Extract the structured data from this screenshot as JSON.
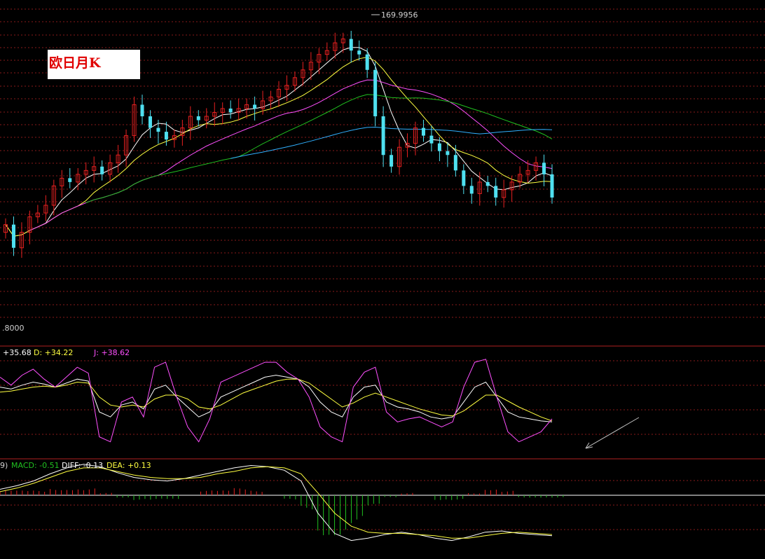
{
  "title": "欧日月K",
  "high_label": "169.9956",
  "low_axis_label": ".8000",
  "kdj": {
    "label_k": "+35.68",
    "label_d": "D: +34.22",
    "label_j": "J: +38.62"
  },
  "macd": {
    "label_prefix": "9)",
    "label_macd": "MACD: -0.51",
    "label_diff": "DIFF: -0.13",
    "label_dea": "DEA: +0.13"
  },
  "colors": {
    "background": "#000000",
    "grid": "#8a1a1a",
    "up": "#e82020",
    "down": "#4fe0f0",
    "ma5": "#ffffff",
    "ma10": "#ffff40",
    "ma20": "#ff50ff",
    "ma30": "#20c020",
    "ma60": "#30b0ff",
    "kdj_k": "#ffffff",
    "kdj_d": "#ffff40",
    "kdj_j": "#ff50ff",
    "macd_diff": "#ffffff",
    "macd_dea": "#ffff40",
    "macd_pos": "#e82020",
    "macd_neg": "#20c020"
  },
  "chart_data": [
    {
      "type": "candlestick",
      "title": "欧日月K",
      "y_labels_visible": [
        ".8000",
        "169.9956"
      ],
      "series": [
        {
          "name": "price",
          "close": [
            118,
            112,
            116,
            120,
            121,
            123,
            128,
            130,
            129,
            131,
            132,
            133,
            131,
            134,
            136,
            141,
            149,
            146,
            143,
            142,
            140,
            141,
            143,
            146,
            145,
            146,
            147,
            148,
            147,
            148,
            149,
            148,
            150,
            151,
            153,
            154,
            156,
            158,
            160,
            162,
            163,
            165,
            166,
            163,
            162,
            158,
            146,
            136,
            133,
            138,
            139,
            143,
            141,
            139,
            137,
            136,
            132,
            128,
            126,
            129,
            128,
            125,
            127,
            129,
            131,
            132,
            134,
            131,
            125
          ]
        }
      ]
    },
    {
      "type": "line",
      "title": "KDJ",
      "series": [
        {
          "name": "K",
          "values": [
            70,
            68,
            72,
            75,
            73,
            70,
            74,
            78,
            76,
            45,
            40,
            52,
            55,
            48,
            68,
            72,
            60,
            50,
            40,
            45,
            60,
            65,
            70,
            75,
            80,
            82,
            80,
            78,
            70,
            55,
            45,
            40,
            60,
            70,
            72,
            55,
            50,
            48,
            45,
            40,
            38,
            40,
            55,
            70,
            75,
            60,
            45,
            40,
            38,
            36,
            35
          ]
        },
        {
          "name": "D",
          "values": [
            65,
            66,
            68,
            70,
            71,
            70,
            72,
            75,
            74,
            60,
            52,
            50,
            52,
            50,
            58,
            62,
            62,
            58,
            50,
            48,
            52,
            58,
            64,
            68,
            72,
            76,
            78,
            78,
            74,
            66,
            58,
            50,
            54,
            60,
            64,
            60,
            56,
            52,
            48,
            45,
            42,
            41,
            46,
            54,
            62,
            62,
            56,
            50,
            45,
            40,
            36
          ]
        },
        {
          "name": "J",
          "values": [
            80,
            72,
            82,
            88,
            78,
            70,
            80,
            90,
            84,
            20,
            15,
            55,
            60,
            40,
            90,
            95,
            60,
            30,
            15,
            38,
            75,
            80,
            85,
            90,
            95,
            95,
            85,
            78,
            60,
            30,
            20,
            15,
            70,
            85,
            90,
            45,
            35,
            38,
            40,
            35,
            30,
            35,
            70,
            95,
            98,
            60,
            25,
            15,
            20,
            25,
            38
          ]
        }
      ]
    },
    {
      "type": "bar",
      "title": "MACD",
      "series": [
        {
          "name": "DIFF",
          "values": [
            0.5,
            0.8,
            1.2,
            1.8,
            2.3,
            2.6,
            2.4,
            1.9,
            1.5,
            1.3,
            1.2,
            1.4,
            1.7,
            2.0,
            2.3,
            2.5,
            2.4,
            2.1,
            1.2,
            -1.5,
            -3.2,
            -3.8,
            -3.6,
            -3.3,
            -3.1,
            -3.3,
            -3.6,
            -3.8,
            -3.5,
            -3.1,
            -3.0,
            -3.2,
            -3.3,
            -3.4
          ]
        },
        {
          "name": "DEA",
          "values": [
            0.3,
            0.6,
            1.0,
            1.5,
            2.0,
            2.3,
            2.3,
            2.0,
            1.7,
            1.5,
            1.4,
            1.4,
            1.5,
            1.8,
            2.0,
            2.3,
            2.4,
            2.3,
            1.8,
            0.2,
            -1.5,
            -2.6,
            -3.1,
            -3.2,
            -3.2,
            -3.3,
            -3.4,
            -3.6,
            -3.6,
            -3.4,
            -3.2,
            -3.1,
            -3.2,
            -3.3
          ]
        }
      ]
    }
  ]
}
